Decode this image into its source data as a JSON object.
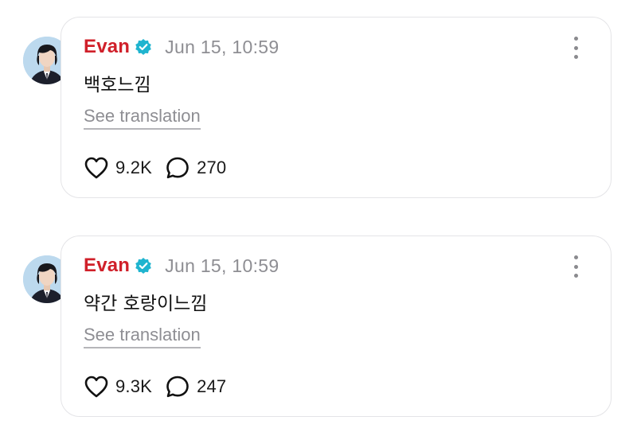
{
  "colors": {
    "author_name": "#d0202a",
    "verified_badge": "#1fb4cf",
    "meta_text": "#8e8e93"
  },
  "posts": [
    {
      "author": "Evan",
      "verified": true,
      "timestamp": "Jun 15, 10:59",
      "text": "백호느낌",
      "translate_label": "See translation",
      "likes": "9.2K",
      "replies": "270",
      "icons": {
        "like": "heart-icon",
        "reply": "speech-bubble-icon",
        "more": "vertical-ellipsis-icon",
        "badge": "verified-check-icon"
      }
    },
    {
      "author": "Evan",
      "verified": true,
      "timestamp": "Jun 15, 10:59",
      "text": "약간 호랑이느낌",
      "translate_label": "See translation",
      "likes": "9.3K",
      "replies": "247",
      "icons": {
        "like": "heart-icon",
        "reply": "speech-bubble-icon",
        "more": "vertical-ellipsis-icon",
        "badge": "verified-check-icon"
      }
    }
  ]
}
